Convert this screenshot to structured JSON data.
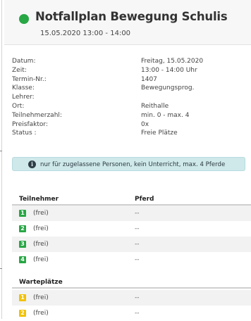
{
  "header": {
    "title": "Notfallplan Bewegung Schulis",
    "subtitle": "15.05.2020   13:00 - 14:00",
    "status_color": "#28a745"
  },
  "details": [
    {
      "label": "Datum:",
      "value": "Freitag, 15.05.2020"
    },
    {
      "label": "Zeit:",
      "value": "13:00 - 14:00 Uhr"
    },
    {
      "label": "Termin-Nr.:",
      "value": "1407"
    },
    {
      "label": "Klasse:",
      "value": "Bewegungsprog."
    },
    {
      "label": "Lehrer:",
      "value": ""
    },
    {
      "label": "Ort:",
      "value": "Reithalle"
    },
    {
      "label": "Teilnehmerzahl:",
      "value": "min. 0 - max. 4"
    },
    {
      "label": "Preisfaktor:",
      "value": "0x"
    },
    {
      "label": "Status :",
      "value": "Freie Plätze"
    }
  ],
  "info": {
    "icon": "info-circle-icon",
    "text": "nur für zugelassene Personen, kein Unterricht, max. 4 Pferde"
  },
  "participants": {
    "col_participant": "Teilnehmer",
    "col_horse": "Pferd",
    "badge_color": "#28a745",
    "rows": [
      {
        "num": "1",
        "name": "(frei)",
        "horse": "--"
      },
      {
        "num": "2",
        "name": "(frei)",
        "horse": "--"
      },
      {
        "num": "3",
        "name": "(frei)",
        "horse": "--"
      },
      {
        "num": "4",
        "name": "(frei)",
        "horse": "--"
      }
    ]
  },
  "waitlist": {
    "heading": "Warteplätze",
    "badge_color": "#f2c200",
    "rows": [
      {
        "num": "1",
        "name": "(frei)",
        "horse": "--"
      },
      {
        "num": "2",
        "name": "(frei)",
        "horse": "--"
      }
    ]
  }
}
